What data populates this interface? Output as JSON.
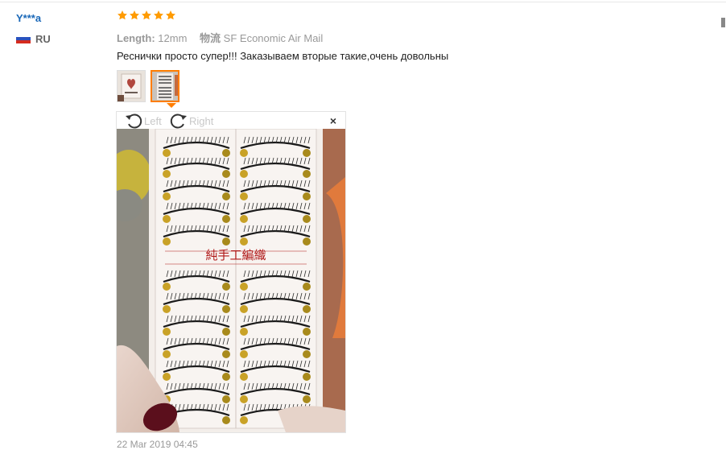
{
  "user": {
    "name": "Y***a",
    "country": "RU",
    "flag_colors": [
      "#ffffff",
      "#2a52be",
      "#d52b1e"
    ]
  },
  "review": {
    "rating": 5,
    "rating_max": 5,
    "star_color": "#ff9b00",
    "length_label": "Length:",
    "length_value": "12mm",
    "shipping_label": "物流",
    "shipping_value": "SF Economic Air Mail",
    "text": "Реснички просто супер!!! Заказываем вторые такие,очень довольны",
    "date": "22 Mar 2019 04:45"
  },
  "gallery": {
    "thumbnails": [
      {
        "icon": "packaging-photo-thumbnail",
        "active": false
      },
      {
        "icon": "lashes-photo-thumbnail",
        "active": true
      }
    ],
    "left_label": "Left",
    "right_label": "Right",
    "close_label": "×",
    "box_label": "純手工編織",
    "accent_color": "#ff7d00"
  }
}
